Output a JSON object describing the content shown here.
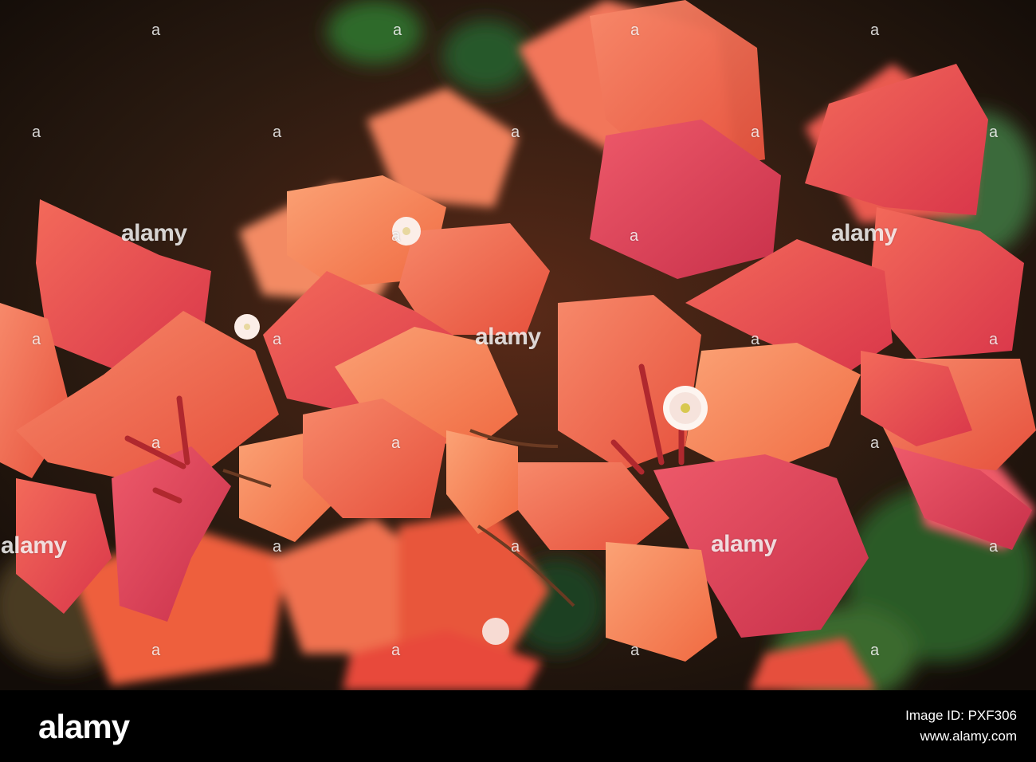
{
  "watermark": {
    "text": "alamy",
    "dot": "a"
  },
  "footer": {
    "brand": "alamy",
    "image_id": "Image ID: PXF306",
    "site": "www.alamy.com"
  },
  "colors": {
    "background_dark": "#1a120c",
    "bract_orange": "#f06a45",
    "bract_pink": "#e84a5a",
    "bract_coral": "#f58a62",
    "foliage_green": "#2f5a2a",
    "floret_white": "#fdf5f0",
    "footer_bg": "#000000"
  }
}
